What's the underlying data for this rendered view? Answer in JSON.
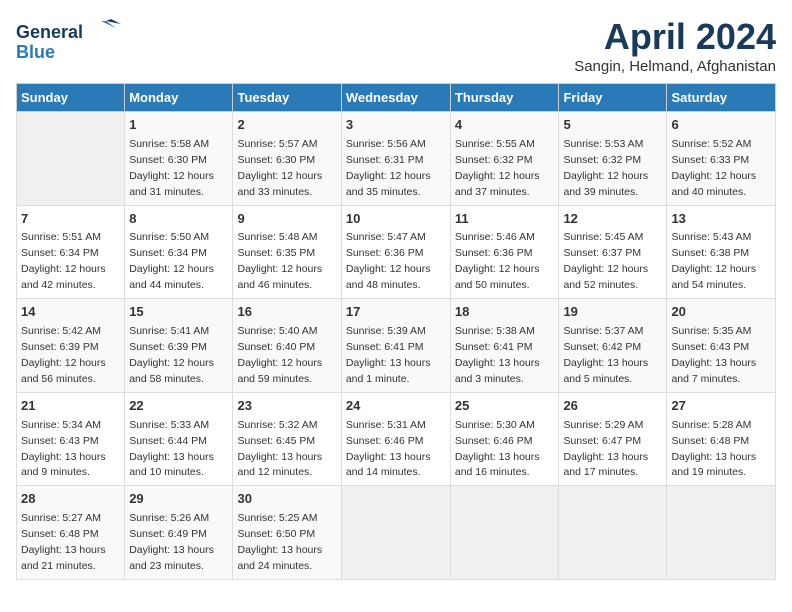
{
  "logo": {
    "line1": "General",
    "line2": "Blue"
  },
  "title": "April 2024",
  "location": "Sangin, Helmand, Afghanistan",
  "days_of_week": [
    "Sunday",
    "Monday",
    "Tuesday",
    "Wednesday",
    "Thursday",
    "Friday",
    "Saturday"
  ],
  "weeks": [
    [
      {
        "day": "",
        "empty": true
      },
      {
        "day": "1",
        "sunrise": "5:58 AM",
        "sunset": "6:30 PM",
        "daylight": "12 hours and 31 minutes."
      },
      {
        "day": "2",
        "sunrise": "5:57 AM",
        "sunset": "6:30 PM",
        "daylight": "12 hours and 33 minutes."
      },
      {
        "day": "3",
        "sunrise": "5:56 AM",
        "sunset": "6:31 PM",
        "daylight": "12 hours and 35 minutes."
      },
      {
        "day": "4",
        "sunrise": "5:55 AM",
        "sunset": "6:32 PM",
        "daylight": "12 hours and 37 minutes."
      },
      {
        "day": "5",
        "sunrise": "5:53 AM",
        "sunset": "6:32 PM",
        "daylight": "12 hours and 39 minutes."
      },
      {
        "day": "6",
        "sunrise": "5:52 AM",
        "sunset": "6:33 PM",
        "daylight": "12 hours and 40 minutes."
      }
    ],
    [
      {
        "day": "7",
        "sunrise": "5:51 AM",
        "sunset": "6:34 PM",
        "daylight": "12 hours and 42 minutes."
      },
      {
        "day": "8",
        "sunrise": "5:50 AM",
        "sunset": "6:34 PM",
        "daylight": "12 hours and 44 minutes."
      },
      {
        "day": "9",
        "sunrise": "5:48 AM",
        "sunset": "6:35 PM",
        "daylight": "12 hours and 46 minutes."
      },
      {
        "day": "10",
        "sunrise": "5:47 AM",
        "sunset": "6:36 PM",
        "daylight": "12 hours and 48 minutes."
      },
      {
        "day": "11",
        "sunrise": "5:46 AM",
        "sunset": "6:36 PM",
        "daylight": "12 hours and 50 minutes."
      },
      {
        "day": "12",
        "sunrise": "5:45 AM",
        "sunset": "6:37 PM",
        "daylight": "12 hours and 52 minutes."
      },
      {
        "day": "13",
        "sunrise": "5:43 AM",
        "sunset": "6:38 PM",
        "daylight": "12 hours and 54 minutes."
      }
    ],
    [
      {
        "day": "14",
        "sunrise": "5:42 AM",
        "sunset": "6:39 PM",
        "daylight": "12 hours and 56 minutes."
      },
      {
        "day": "15",
        "sunrise": "5:41 AM",
        "sunset": "6:39 PM",
        "daylight": "12 hours and 58 minutes."
      },
      {
        "day": "16",
        "sunrise": "5:40 AM",
        "sunset": "6:40 PM",
        "daylight": "12 hours and 59 minutes."
      },
      {
        "day": "17",
        "sunrise": "5:39 AM",
        "sunset": "6:41 PM",
        "daylight": "13 hours and 1 minute."
      },
      {
        "day": "18",
        "sunrise": "5:38 AM",
        "sunset": "6:41 PM",
        "daylight": "13 hours and 3 minutes."
      },
      {
        "day": "19",
        "sunrise": "5:37 AM",
        "sunset": "6:42 PM",
        "daylight": "13 hours and 5 minutes."
      },
      {
        "day": "20",
        "sunrise": "5:35 AM",
        "sunset": "6:43 PM",
        "daylight": "13 hours and 7 minutes."
      }
    ],
    [
      {
        "day": "21",
        "sunrise": "5:34 AM",
        "sunset": "6:43 PM",
        "daylight": "13 hours and 9 minutes."
      },
      {
        "day": "22",
        "sunrise": "5:33 AM",
        "sunset": "6:44 PM",
        "daylight": "13 hours and 10 minutes."
      },
      {
        "day": "23",
        "sunrise": "5:32 AM",
        "sunset": "6:45 PM",
        "daylight": "13 hours and 12 minutes."
      },
      {
        "day": "24",
        "sunrise": "5:31 AM",
        "sunset": "6:46 PM",
        "daylight": "13 hours and 14 minutes."
      },
      {
        "day": "25",
        "sunrise": "5:30 AM",
        "sunset": "6:46 PM",
        "daylight": "13 hours and 16 minutes."
      },
      {
        "day": "26",
        "sunrise": "5:29 AM",
        "sunset": "6:47 PM",
        "daylight": "13 hours and 17 minutes."
      },
      {
        "day": "27",
        "sunrise": "5:28 AM",
        "sunset": "6:48 PM",
        "daylight": "13 hours and 19 minutes."
      }
    ],
    [
      {
        "day": "28",
        "sunrise": "5:27 AM",
        "sunset": "6:48 PM",
        "daylight": "13 hours and 21 minutes."
      },
      {
        "day": "29",
        "sunrise": "5:26 AM",
        "sunset": "6:49 PM",
        "daylight": "13 hours and 23 minutes."
      },
      {
        "day": "30",
        "sunrise": "5:25 AM",
        "sunset": "6:50 PM",
        "daylight": "13 hours and 24 minutes."
      },
      {
        "day": "",
        "empty": true
      },
      {
        "day": "",
        "empty": true
      },
      {
        "day": "",
        "empty": true
      },
      {
        "day": "",
        "empty": true
      }
    ]
  ]
}
